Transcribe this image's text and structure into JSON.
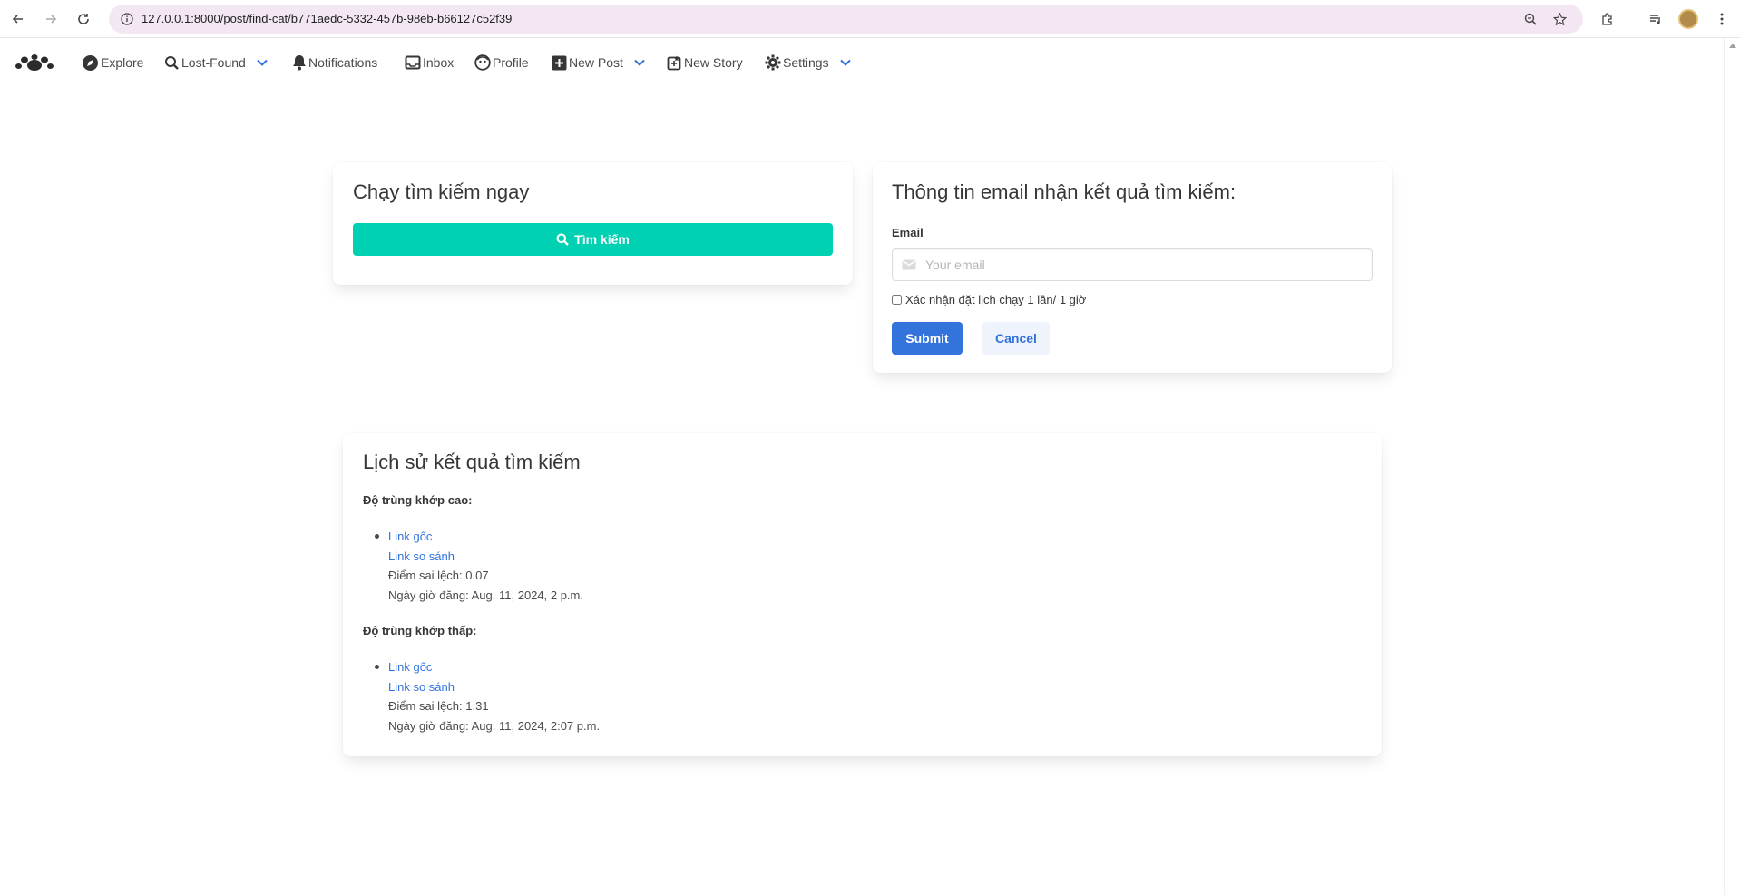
{
  "browser": {
    "url": "127.0.0.1:8000/post/find-cat/b771aedc-5332-457b-98eb-b66127c52f39"
  },
  "nav": {
    "items": [
      {
        "label": "Explore"
      },
      {
        "label": "Lost-Found"
      },
      {
        "label": "Notifications"
      },
      {
        "label": "Inbox"
      },
      {
        "label": "Profile"
      },
      {
        "label": "New Post"
      },
      {
        "label": "New Story"
      },
      {
        "label": "Settings"
      }
    ]
  },
  "search_card": {
    "title": "Chạy tìm kiếm ngay",
    "button_label": "Tìm kiếm"
  },
  "email_card": {
    "title": "Thông tin email nhận kết quả tìm kiếm:",
    "email_label": "Email",
    "email_placeholder": "Your email",
    "email_value": "",
    "schedule_label": "Xác nhận đặt lịch chạy 1 lần/ 1 giờ",
    "schedule_checked": false,
    "submit_label": "Submit",
    "cancel_label": "Cancel"
  },
  "history": {
    "title": "Lịch sử kết quả tìm kiếm",
    "groups": [
      {
        "heading": "Độ trùng khớp cao:",
        "results": [
          {
            "original_link": "Link gốc",
            "compare_link": "Link so sánh",
            "score": "Điểm sai lệch: 0.07",
            "posted": "Ngày giờ đăng: Aug. 11, 2024, 2 p.m."
          }
        ]
      },
      {
        "heading": "Độ trùng khớp thấp:",
        "results": [
          {
            "original_link": "Link gốc",
            "compare_link": "Link so sánh",
            "score": "Điểm sai lệch: 1.31",
            "posted": "Ngày giờ đăng: Aug. 11, 2024, 2:07 p.m."
          }
        ]
      }
    ]
  },
  "colors": {
    "primary": "#3273dc",
    "turquoise": "#00d1b2",
    "url_bar": "#f3e7f3",
    "text": "#363636"
  }
}
